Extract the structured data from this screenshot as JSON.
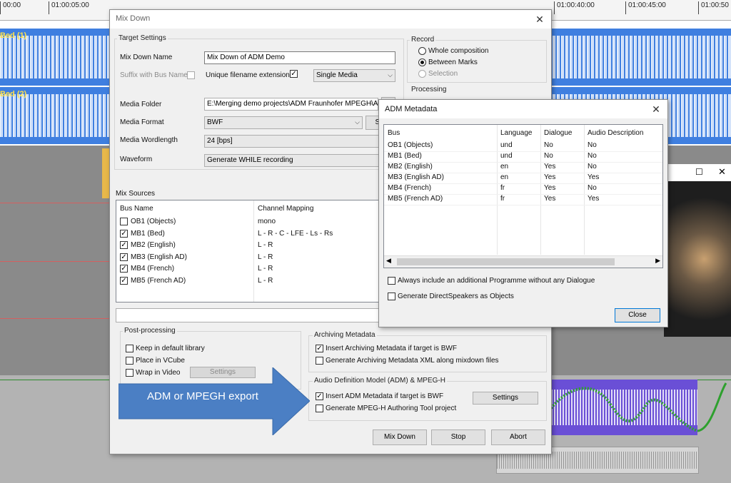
{
  "timeline": {
    "ticks": [
      "00:00",
      "01:00:05:00",
      "01:00:40:00",
      "01:00:45:00",
      "01:00:50"
    ],
    "tracks": [
      "Bed (1)",
      "Bed (2)"
    ]
  },
  "mixdown": {
    "title": "Mix Down",
    "target_settings": {
      "group_label": "Target Settings",
      "name_label": "Mix Down Name",
      "name_value": "Mix Down of ADM Demo",
      "suffix_label": "Suffix with Bus Name",
      "unique_label": "Unique filename extension",
      "unique_checked": true,
      "media_mode": "Single Media",
      "folder_label": "Media Folder",
      "folder_value": "E:\\Merging demo projects\\ADM Fraunhofer MPEGH\\A",
      "format_label": "Media Format",
      "format_value": "BWF",
      "format_settings": "Set",
      "wordlength_label": "Media Wordlength",
      "wordlength_value": "24 [bps]",
      "waveform_label": "Waveform",
      "waveform_value": "Generate WHILE recording"
    },
    "record": {
      "group_label": "Record",
      "options": [
        "Whole composition",
        "Between Marks",
        "Selection"
      ],
      "selected": "Between Marks"
    },
    "processing": {
      "group_label": "Processing"
    },
    "mix_sources": {
      "label": "Mix Sources",
      "col_bus": "Bus Name",
      "col_mapping": "Channel Mapping",
      "rows": [
        {
          "bus": "OB1 (Objects)",
          "mapping": "mono",
          "checked": false
        },
        {
          "bus": "MB1 (Bed)",
          "mapping": "L - R - C - LFE - Ls - Rs",
          "checked": true
        },
        {
          "bus": "MB2 (English)",
          "mapping": "L - R",
          "checked": true
        },
        {
          "bus": "MB3 (English AD)",
          "mapping": "L - R",
          "checked": true
        },
        {
          "bus": "MB4 (French)",
          "mapping": "L - R",
          "checked": true
        },
        {
          "bus": "MB5 (French AD)",
          "mapping": "L - R",
          "checked": true
        }
      ]
    },
    "post_processing": {
      "group_label": "Post-processing",
      "keep_label": "Keep in default library",
      "vcube_label": "Place in VCube",
      "wrap_label": "Wrap in Video",
      "settings_label": "Settings"
    },
    "archiving": {
      "group_label": "Archiving Metadata",
      "insert_label": "Insert Archiving Metadata if target is BWF",
      "insert_checked": true,
      "xml_label": "Generate Archiving Metadata XML along mixdown files"
    },
    "adm": {
      "group_label": "Audio Definition Model (ADM) & MPEG-H",
      "insert_label": "Insert ADM Metadata if target is BWF",
      "insert_checked": true,
      "mpegh_label": "Generate MPEG-H Authoring Tool project",
      "settings_label": "Settings"
    },
    "buttons": {
      "mix_down": "Mix Down",
      "stop": "Stop",
      "abort": "Abort"
    }
  },
  "adm_dialog": {
    "title": "ADM Metadata",
    "columns": [
      "Bus",
      "Language",
      "Dialogue",
      "Audio Description"
    ],
    "rows": [
      [
        "OB1 (Objects)",
        "und",
        "No",
        "No"
      ],
      [
        "MB1 (Bed)",
        "und",
        "No",
        "No"
      ],
      [
        "MB2 (English)",
        "en",
        "Yes",
        "No"
      ],
      [
        "MB3 (English AD)",
        "en",
        "Yes",
        "Yes"
      ],
      [
        "MB4 (French)",
        "fr",
        "Yes",
        "No"
      ],
      [
        "MB5 (French AD)",
        "fr",
        "Yes",
        "Yes"
      ]
    ],
    "opt_programme": "Always include an additional Programme without any Dialogue",
    "opt_direct": "Generate DirectSpeakers as Objects",
    "close_label": "Close"
  },
  "annotation": {
    "text": "ADM or MPEGH export",
    "color": "#4b7fc4"
  }
}
